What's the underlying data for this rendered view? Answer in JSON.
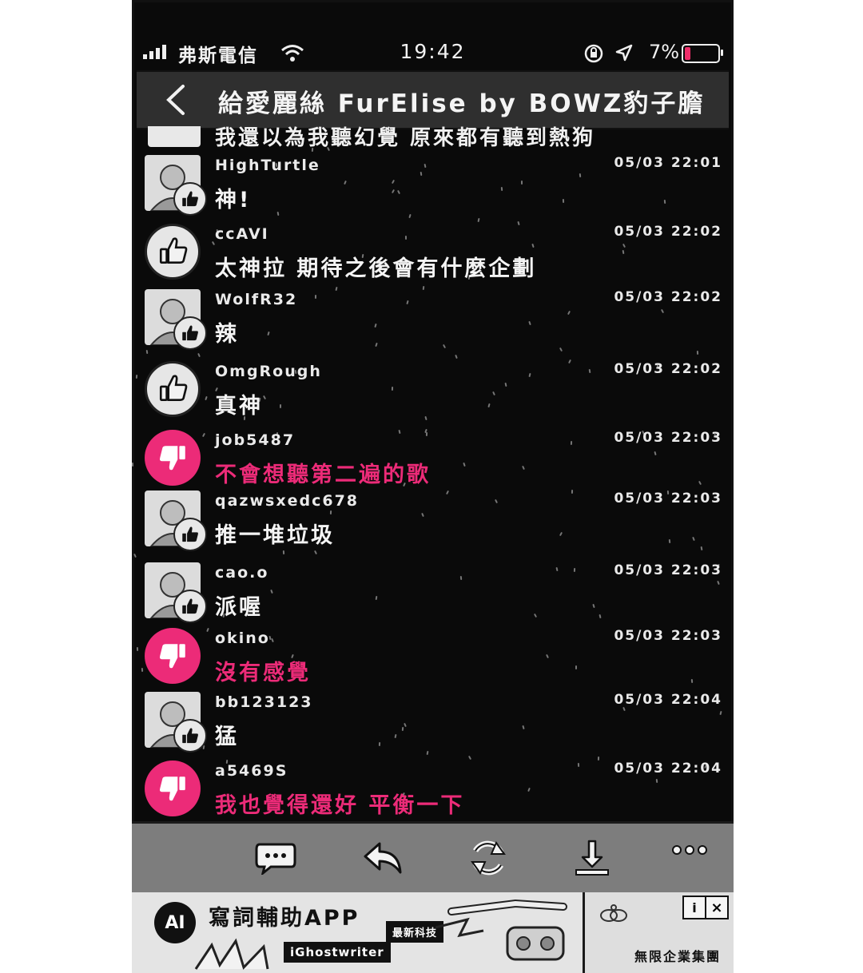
{
  "status": {
    "carrier": "弗斯電信",
    "time": "19:42",
    "battery_percent": "7%",
    "battery_level": 0.07,
    "battery_color": "#ee2e6a"
  },
  "nav": {
    "title": "給愛麗絲 FurElise by BOWZ豹子膽",
    "back_icon": "chevron-left-icon"
  },
  "partial_comment": {
    "message": "我還以為我聽幻覺  原來都有聽到熱狗"
  },
  "comments": [
    {
      "user": "HighTurtle",
      "time": "05/03  22:01",
      "message": "神!",
      "sentiment": "like",
      "avatar": "photo"
    },
    {
      "user": "ccAVI",
      "time": "05/03  22:02",
      "message": "太神拉  期待之後會有什麼企劃",
      "sentiment": "like",
      "avatar": "badge"
    },
    {
      "user": "WolfR32",
      "time": "05/03  22:02",
      "message": "辣",
      "sentiment": "like",
      "avatar": "photo"
    },
    {
      "user": "OmgRough",
      "time": "05/03  22:02",
      "message": "真神",
      "sentiment": "like",
      "avatar": "badge"
    },
    {
      "user": "job5487",
      "time": "05/03  22:03",
      "message": "不會想聽第二遍的歌",
      "sentiment": "dislike",
      "avatar": "badge"
    },
    {
      "user": "qazwsxedc678",
      "time": "05/03  22:03",
      "message": "推一堆垃圾",
      "sentiment": "like",
      "avatar": "photo"
    },
    {
      "user": "cao.o",
      "time": "05/03  22:03",
      "message": "派喔",
      "sentiment": "like",
      "avatar": "photo"
    },
    {
      "user": "okino",
      "time": "05/03  22:03",
      "message": "沒有感覺",
      "sentiment": "dislike",
      "avatar": "badge"
    },
    {
      "user": "bb123123",
      "time": "05/03  22:04",
      "message": "猛",
      "sentiment": "like",
      "avatar": "photo"
    },
    {
      "user": "a5469S",
      "time": "05/03  22:04",
      "message": "我也覺得還好  平衡一下",
      "sentiment": "dislike",
      "avatar": "badge"
    }
  ],
  "toolbar": {
    "items": [
      "comment-icon",
      "reply-icon",
      "refresh-icon",
      "download-icon",
      "more-icon"
    ]
  },
  "ad": {
    "badge": "AI",
    "title": "寫詞輔助APP",
    "tag": "最新科技",
    "brand": "iGhostwriter",
    "sponsor": "無限企業集團",
    "info_label": "i",
    "close_label": "×"
  },
  "colors": {
    "background": "#0a0a0a",
    "text": "#f4f4f4",
    "negative": "#ec2b78",
    "toolbar": "#7d7d7d"
  }
}
